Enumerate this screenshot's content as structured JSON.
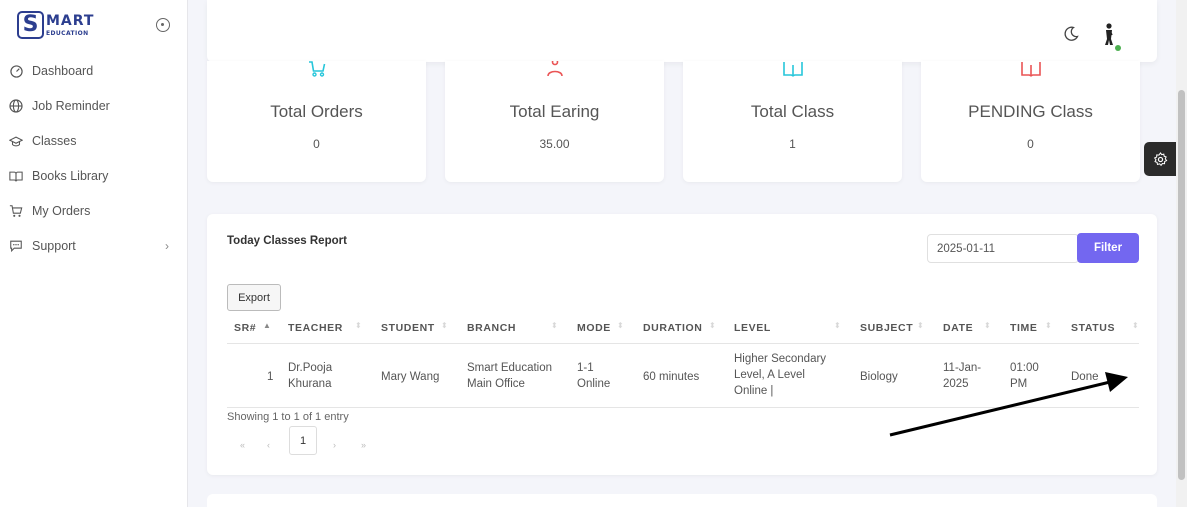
{
  "brand": {
    "logo_letter": "S",
    "name": "MART",
    "tagline": "EDUCATION"
  },
  "sidebar": {
    "items": [
      {
        "label": "Dashboard",
        "icon": "dashboard-icon"
      },
      {
        "label": "Job Reminder",
        "icon": "globe-icon"
      },
      {
        "label": "Classes",
        "icon": "graduation-cap-icon"
      },
      {
        "label": "Books Library",
        "icon": "book-icon"
      },
      {
        "label": "My Orders",
        "icon": "cart-icon"
      },
      {
        "label": "Support",
        "icon": "message-icon",
        "has_submenu": true
      }
    ],
    "submenu_chevron": "›"
  },
  "topbar": {
    "theme_icon": "moon-icon",
    "user_icon": "avatar-icon",
    "status_color": "#4caf50"
  },
  "stats": [
    {
      "title": "Total Orders",
      "value": "0",
      "icon": "cart-icon",
      "color": "#26c6da"
    },
    {
      "title": "Total Earing",
      "value": "35.00",
      "icon": "user-icon",
      "color": "#ea5455"
    },
    {
      "title": "Total Class",
      "value": "1",
      "icon": "book-icon",
      "color": "#26c6da"
    },
    {
      "title": "PENDING Class",
      "value": "0",
      "icon": "book-icon",
      "color": "#ea5455"
    }
  ],
  "report": {
    "title": "Today Classes Report",
    "date_value": "2025-01-11",
    "filter_label": "Filter",
    "export_label": "Export",
    "columns": [
      "SR#",
      "TEACHER",
      "STUDENT",
      "BRANCH",
      "MODE",
      "DURATION",
      "LEVEL",
      "SUBJECT",
      "DATE",
      "TIME",
      "STATUS"
    ],
    "rows": [
      {
        "sr": "1",
        "teacher": [
          "Dr.Pooja",
          "Khurana"
        ],
        "student": "Mary Wang",
        "branch": [
          "Smart Education",
          "Main Office"
        ],
        "mode": [
          "1-1",
          "Online"
        ],
        "duration": "60 minutes",
        "level": [
          "Higher Secondary",
          "Level, A Level",
          "Online |"
        ],
        "subject": "Biology",
        "date": [
          "11-Jan-",
          "2025"
        ],
        "time": [
          "01:00",
          "PM"
        ],
        "status": "Done"
      }
    ],
    "showing": "Showing 1 to 1 of 1 entry",
    "pagination": {
      "first": "«",
      "prev": "‹",
      "current": "1",
      "next": "›",
      "last": "»"
    }
  },
  "settings_icon": "gear-icon",
  "accent_color": "#7367f0"
}
